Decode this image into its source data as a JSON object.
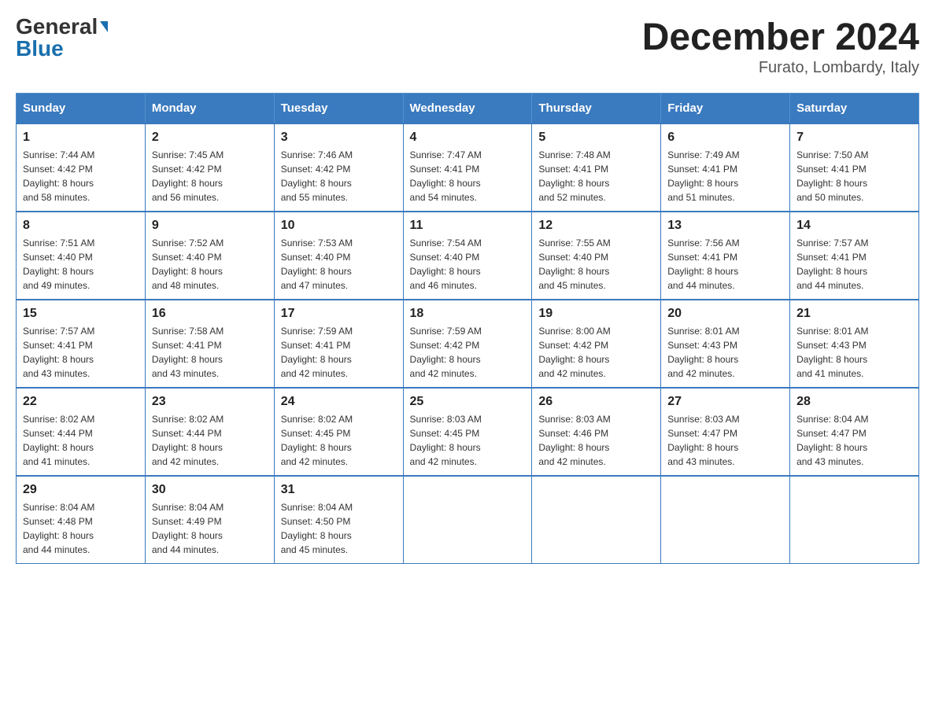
{
  "header": {
    "logo_general": "General",
    "logo_blue": "Blue",
    "month_title": "December 2024",
    "location": "Furato, Lombardy, Italy"
  },
  "days_of_week": [
    "Sunday",
    "Monday",
    "Tuesday",
    "Wednesday",
    "Thursday",
    "Friday",
    "Saturday"
  ],
  "weeks": [
    [
      {
        "day": "1",
        "sunrise": "7:44 AM",
        "sunset": "4:42 PM",
        "daylight": "8 hours and 58 minutes."
      },
      {
        "day": "2",
        "sunrise": "7:45 AM",
        "sunset": "4:42 PM",
        "daylight": "8 hours and 56 minutes."
      },
      {
        "day": "3",
        "sunrise": "7:46 AM",
        "sunset": "4:42 PM",
        "daylight": "8 hours and 55 minutes."
      },
      {
        "day": "4",
        "sunrise": "7:47 AM",
        "sunset": "4:41 PM",
        "daylight": "8 hours and 54 minutes."
      },
      {
        "day": "5",
        "sunrise": "7:48 AM",
        "sunset": "4:41 PM",
        "daylight": "8 hours and 52 minutes."
      },
      {
        "day": "6",
        "sunrise": "7:49 AM",
        "sunset": "4:41 PM",
        "daylight": "8 hours and 51 minutes."
      },
      {
        "day": "7",
        "sunrise": "7:50 AM",
        "sunset": "4:41 PM",
        "daylight": "8 hours and 50 minutes."
      }
    ],
    [
      {
        "day": "8",
        "sunrise": "7:51 AM",
        "sunset": "4:40 PM",
        "daylight": "8 hours and 49 minutes."
      },
      {
        "day": "9",
        "sunrise": "7:52 AM",
        "sunset": "4:40 PM",
        "daylight": "8 hours and 48 minutes."
      },
      {
        "day": "10",
        "sunrise": "7:53 AM",
        "sunset": "4:40 PM",
        "daylight": "8 hours and 47 minutes."
      },
      {
        "day": "11",
        "sunrise": "7:54 AM",
        "sunset": "4:40 PM",
        "daylight": "8 hours and 46 minutes."
      },
      {
        "day": "12",
        "sunrise": "7:55 AM",
        "sunset": "4:40 PM",
        "daylight": "8 hours and 45 minutes."
      },
      {
        "day": "13",
        "sunrise": "7:56 AM",
        "sunset": "4:41 PM",
        "daylight": "8 hours and 44 minutes."
      },
      {
        "day": "14",
        "sunrise": "7:57 AM",
        "sunset": "4:41 PM",
        "daylight": "8 hours and 44 minutes."
      }
    ],
    [
      {
        "day": "15",
        "sunrise": "7:57 AM",
        "sunset": "4:41 PM",
        "daylight": "8 hours and 43 minutes."
      },
      {
        "day": "16",
        "sunrise": "7:58 AM",
        "sunset": "4:41 PM",
        "daylight": "8 hours and 43 minutes."
      },
      {
        "day": "17",
        "sunrise": "7:59 AM",
        "sunset": "4:41 PM",
        "daylight": "8 hours and 42 minutes."
      },
      {
        "day": "18",
        "sunrise": "7:59 AM",
        "sunset": "4:42 PM",
        "daylight": "8 hours and 42 minutes."
      },
      {
        "day": "19",
        "sunrise": "8:00 AM",
        "sunset": "4:42 PM",
        "daylight": "8 hours and 42 minutes."
      },
      {
        "day": "20",
        "sunrise": "8:01 AM",
        "sunset": "4:43 PM",
        "daylight": "8 hours and 42 minutes."
      },
      {
        "day": "21",
        "sunrise": "8:01 AM",
        "sunset": "4:43 PM",
        "daylight": "8 hours and 41 minutes."
      }
    ],
    [
      {
        "day": "22",
        "sunrise": "8:02 AM",
        "sunset": "4:44 PM",
        "daylight": "8 hours and 41 minutes."
      },
      {
        "day": "23",
        "sunrise": "8:02 AM",
        "sunset": "4:44 PM",
        "daylight": "8 hours and 42 minutes."
      },
      {
        "day": "24",
        "sunrise": "8:02 AM",
        "sunset": "4:45 PM",
        "daylight": "8 hours and 42 minutes."
      },
      {
        "day": "25",
        "sunrise": "8:03 AM",
        "sunset": "4:45 PM",
        "daylight": "8 hours and 42 minutes."
      },
      {
        "day": "26",
        "sunrise": "8:03 AM",
        "sunset": "4:46 PM",
        "daylight": "8 hours and 42 minutes."
      },
      {
        "day": "27",
        "sunrise": "8:03 AM",
        "sunset": "4:47 PM",
        "daylight": "8 hours and 43 minutes."
      },
      {
        "day": "28",
        "sunrise": "8:04 AM",
        "sunset": "4:47 PM",
        "daylight": "8 hours and 43 minutes."
      }
    ],
    [
      {
        "day": "29",
        "sunrise": "8:04 AM",
        "sunset": "4:48 PM",
        "daylight": "8 hours and 44 minutes."
      },
      {
        "day": "30",
        "sunrise": "8:04 AM",
        "sunset": "4:49 PM",
        "daylight": "8 hours and 44 minutes."
      },
      {
        "day": "31",
        "sunrise": "8:04 AM",
        "sunset": "4:50 PM",
        "daylight": "8 hours and 45 minutes."
      },
      null,
      null,
      null,
      null
    ]
  ],
  "labels": {
    "sunrise": "Sunrise:",
    "sunset": "Sunset:",
    "daylight": "Daylight:"
  }
}
